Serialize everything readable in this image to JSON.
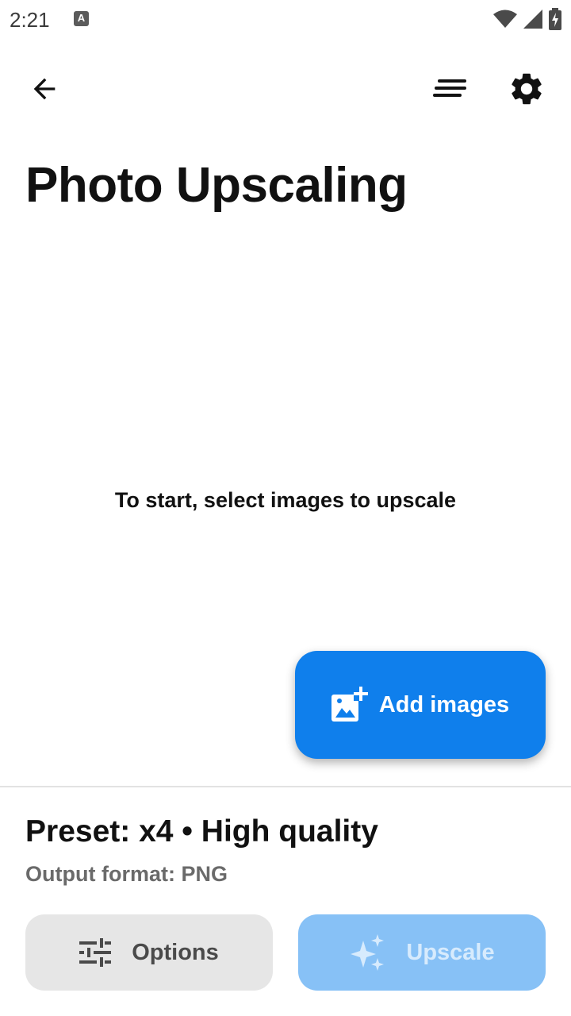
{
  "status_bar": {
    "time": "2:21",
    "notification_icon": "A",
    "icons": [
      "wifi-icon",
      "signal-icon",
      "battery-charging-icon"
    ]
  },
  "app_bar": {
    "back_icon": "arrow-left-icon",
    "sort_icon": "sort-lines-icon",
    "settings_icon": "gear-icon"
  },
  "page": {
    "title": "Photo Upscaling",
    "empty_message": "To start, select images to upscale"
  },
  "fab": {
    "label": "Add images",
    "icon": "add-photo-icon",
    "color": "#0f7fec"
  },
  "bottom_panel": {
    "preset": "Preset: x4 • High quality",
    "output_format": "Output format: PNG",
    "options_label": "Options",
    "options_icon": "sliders-icon",
    "upscale_label": "Upscale",
    "upscale_icon": "sparkles-icon",
    "upscale_enabled": false
  }
}
